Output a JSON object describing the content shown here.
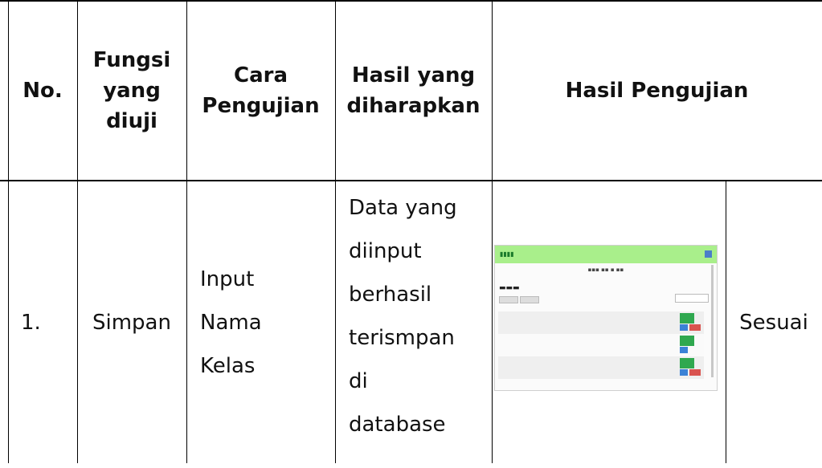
{
  "table": {
    "headers": {
      "no": "No.",
      "fungsi": [
        "Fungsi",
        "yang",
        "diuji"
      ],
      "cara": [
        "Cara",
        "Pengujian"
      ],
      "hasil_harap": [
        "Hasil yang",
        "diharapkan"
      ],
      "hasil_uji": "Hasil Pengujian"
    },
    "rows": [
      {
        "no": "1.",
        "fungsi": "Simpan",
        "cara": [
          "Input",
          "Nama",
          "Kelas"
        ],
        "hasil_harap": [
          "Data yang",
          "diinput",
          "berhasil",
          "terismpan",
          "di",
          "database"
        ],
        "hasil_uji_status": "Sesuai"
      }
    ]
  }
}
